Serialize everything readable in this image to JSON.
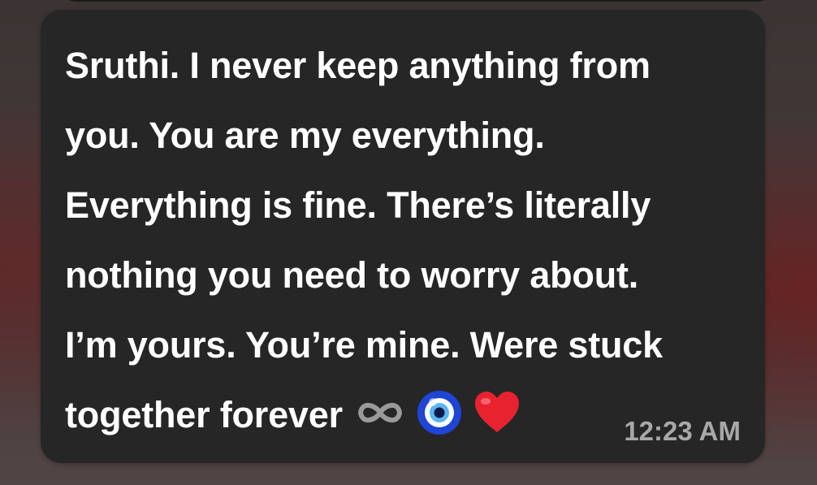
{
  "message": {
    "lines": [
      "Sruthi. I never keep anything from",
      "you. You are my everything.",
      "Everything is fine. There’s literally",
      "nothing you need to worry about.",
      "I’m yours. You’re mine. Were stuck",
      "together forever"
    ],
    "emojis": [
      "infinity-icon",
      "nazar-amulet-icon",
      "red-heart-icon"
    ],
    "time": "12:23 AM"
  },
  "colors": {
    "bubble": "#262626",
    "text": "#ffffff",
    "timestamp": "#a8a8a8",
    "heart": "#e8232f",
    "nazar_blue": "#1f45d6"
  }
}
